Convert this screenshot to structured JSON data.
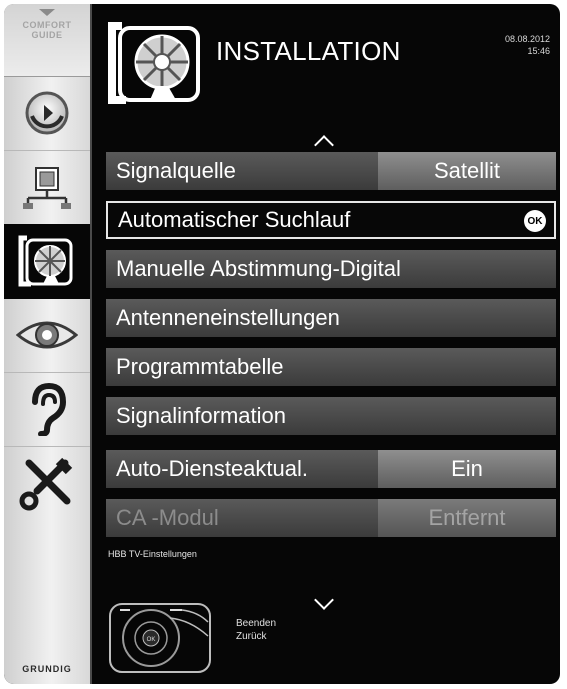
{
  "sidebar": {
    "comfort_guide_line1": "COMFORT",
    "comfort_guide_line2": "GUIDE",
    "items": [
      {
        "icon": "source-refresh-icon"
      },
      {
        "icon": "network-icon"
      },
      {
        "icon": "satellite-dish-icon",
        "active": true
      },
      {
        "icon": "eye-icon"
      },
      {
        "icon": "ear-icon"
      },
      {
        "icon": "tools-icon"
      }
    ],
    "brand": "GRUNDIG"
  },
  "header": {
    "title": "INSTALLATION",
    "date": "08.08.2012",
    "time": "15:46",
    "icon": "satellite-dish-icon"
  },
  "menu": [
    {
      "label": "Signalquelle",
      "value": "Satellit"
    },
    {
      "label": "Automatischer Suchlauf",
      "badge": "OK",
      "selected": true
    },
    {
      "label": "Manuelle Abstimmung-Digital"
    },
    {
      "label": "Antenneneinstellungen"
    },
    {
      "label": "Programmtabelle"
    },
    {
      "label": "Signalinformation"
    },
    {
      "label": "Auto-Diensteaktual.",
      "value": "Ein"
    },
    {
      "label": "CA -Modul",
      "value": "Entfernt",
      "disabled": true
    }
  ],
  "hbb_label": "HBB TV-Einstellungen",
  "footer": {
    "remote_icon": "remote-control-icon",
    "remote_center": "OK",
    "hint_exit": "Beenden",
    "hint_back": "Zurück"
  },
  "colors": {
    "background": "#060606",
    "row": "#4a4a4a",
    "value_box": "#7a7a7a",
    "selected_border": "#e6e6e6"
  }
}
